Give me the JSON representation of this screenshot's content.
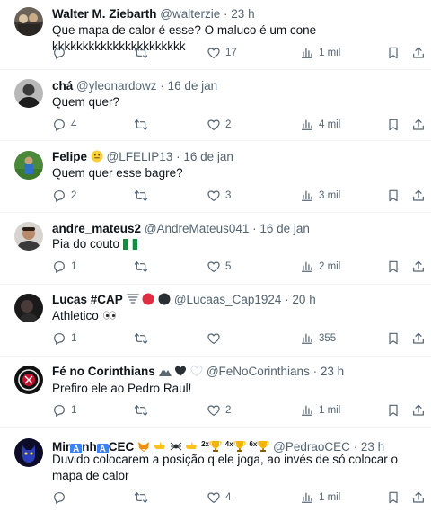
{
  "colors": {
    "text": "#0f1419",
    "muted": "#536471",
    "divider": "#eff3f4"
  },
  "posts": [
    {
      "name": "Walter M. Ziebarth",
      "handle": "@walterzie",
      "time": "23 h",
      "text": "Que mapa de calor é esse? O maluco é um cone kkkkkkkkkkkkkkkkkkkkkk",
      "reply": "",
      "retweet": "",
      "like": "17",
      "views": "1 mil"
    },
    {
      "name": "chá",
      "handle": "@yleonardowz",
      "time": "16 de jan",
      "text": "Quem quer?",
      "reply": "4",
      "retweet": "",
      "like": "2",
      "views": "4 mil"
    },
    {
      "name": "Felipe",
      "handle": "@LFELIP13",
      "time": "16 de jan",
      "text": "Quem quer esse bagre?",
      "reply": "2",
      "retweet": "",
      "like": "3",
      "views": "3 mil"
    },
    {
      "name": "andre_mateus2",
      "handle": "@AndreMateus041",
      "time": "16 de jan",
      "text": "Pia do couto",
      "reply": "1",
      "retweet": "",
      "like": "5",
      "views": "2 mil"
    },
    {
      "name": "Lucas #CAP",
      "handle": "@Lucaas_Cap1924",
      "time": "20 h",
      "text": "Athletico",
      "reply": "1",
      "retweet": "",
      "like": "",
      "views": "355"
    },
    {
      "name": "Fé no Corinthians",
      "handle": "@FeNoCorinthians",
      "time": "23 h",
      "text": "Prefiro ele ao Pedro Raul!",
      "reply": "1",
      "retweet": "",
      "like": "2",
      "views": "1 mil"
    },
    {
      "name_parts": [
        "Mir",
        "A",
        "nh",
        "A",
        "CEC"
      ],
      "badges": [
        "2x",
        "4x",
        "6x"
      ],
      "handle": "@PedraoCEC",
      "time": "23 h",
      "text": "Duvido colocarem a posição q ele joga, ao invés de só colocar o mapa de calor",
      "reply": "",
      "retweet": "",
      "like": "4",
      "views": "1 mil"
    }
  ],
  "separator": "·"
}
